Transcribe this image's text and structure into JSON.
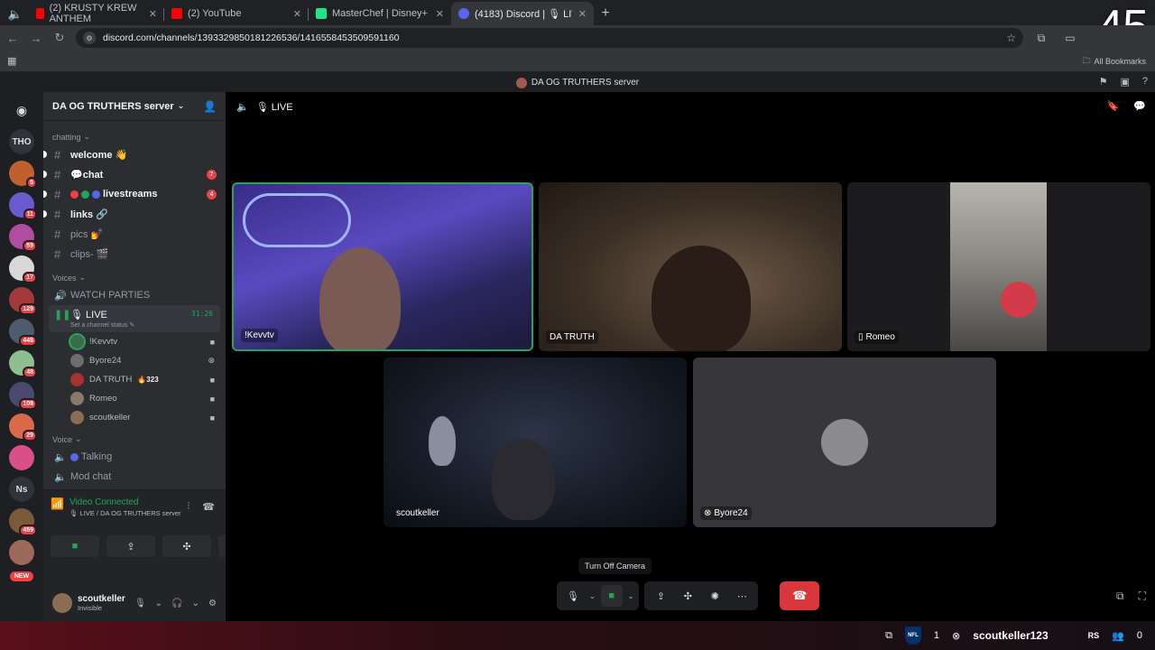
{
  "browser": {
    "tabs": [
      {
        "label": "(2) KRUSTY KREW ANTHEM",
        "favicon_color": "#ff0000",
        "active": false
      },
      {
        "label": "(2) YouTube",
        "favicon_color": "#ff0000",
        "active": false
      },
      {
        "label": "MasterChef | Disney+",
        "favicon_color": "#1ce783",
        "active": false
      },
      {
        "label": "(4183) Discord | 🎙 LIVE | D",
        "favicon_color": "#5865f2",
        "active": true
      }
    ],
    "new_tab": "+",
    "url": "discord.com/channels/1393329850181226536/1416558453509591160",
    "bookmarks_label": "All Bookmarks",
    "overlay_number": "45"
  },
  "discord": {
    "window_title": "DA OG TRUTHERS server",
    "server_name": "DA OG TRUTHERS server",
    "rail": [
      {
        "type": "logo"
      },
      {
        "type": "text",
        "label": "THO"
      },
      {
        "type": "avatar",
        "color": "#c0602f",
        "badge": "5"
      },
      {
        "type": "avatar",
        "color": "#6a5acd",
        "badge": "11"
      },
      {
        "type": "avatar",
        "color": "#b04da0",
        "badge": "59"
      },
      {
        "type": "avatar",
        "color": "#d8d8d8",
        "badge": "17"
      },
      {
        "type": "avatar",
        "color": "#a33a3a",
        "badge": "129"
      },
      {
        "type": "avatar",
        "color": "#4e5a6e",
        "badge": "448"
      },
      {
        "type": "avatar",
        "color": "#8fbf8f",
        "badge": "48"
      },
      {
        "type": "avatar",
        "color": "#4a4a70",
        "badge": "108"
      },
      {
        "type": "avatar",
        "color": "#d86a4a",
        "badge": "29"
      },
      {
        "type": "avatar",
        "color": "#d94f88",
        "badge": ""
      },
      {
        "type": "text",
        "label": "Ns"
      },
      {
        "type": "avatar",
        "color": "#7a5a3a",
        "badge": "459"
      },
      {
        "type": "avatar",
        "color": "#9a6a5a",
        "badge": ""
      },
      {
        "type": "new",
        "label": "NEW"
      }
    ],
    "categories": {
      "chatting": "chatting",
      "voices": "Voices",
      "voice": "Voice"
    },
    "text_channels": [
      {
        "name": "welcome 👋",
        "unread": true,
        "count": ""
      },
      {
        "name": "💬chat",
        "unread": true,
        "count": "7"
      },
      {
        "name": "livestreams",
        "unread": true,
        "count": "4",
        "dots": [
          "#f23f43",
          "#23a55a",
          "#5865f2"
        ]
      },
      {
        "name": "links 🔗",
        "unread": true,
        "count": ""
      },
      {
        "name": "pics 💅",
        "unread": false,
        "count": ""
      },
      {
        "name": "clips- 🎬",
        "unread": false,
        "count": ""
      }
    ],
    "watch_parties": "WATCH PARTIES",
    "live_channel": {
      "name": "🎙 LIVE",
      "timer": "31:26",
      "sub": "Set a channel status ✎"
    },
    "voice_members": [
      {
        "name": "!Kevvtv",
        "avatar_color": "#3c6a4a",
        "speaking": true,
        "fire": ""
      },
      {
        "name": "Byore24",
        "avatar_color": "#6d6d70",
        "speaking": false,
        "fire": ""
      },
      {
        "name": "DA TRUTH",
        "avatar_color": "#a83232",
        "speaking": false,
        "fire": "🔥323"
      },
      {
        "name": "Romeo",
        "avatar_color": "#8a7a6a",
        "speaking": false,
        "fire": ""
      },
      {
        "name": "scoutkeller",
        "avatar_color": "#8a6d52",
        "speaking": false,
        "fire": ""
      }
    ],
    "voice_channels": [
      {
        "name": "Talking",
        "dot": "#5865f2"
      },
      {
        "name": "Mod chat",
        "dot": ""
      }
    ],
    "rtc": {
      "status": "Video Connected",
      "where": "🎙 LIVE / DA OG TRUTHERS server"
    },
    "user": {
      "name": "scoutkeller",
      "status": "Invisible"
    },
    "stage": {
      "channel": "🎙 LIVE",
      "tiles": {
        "kevvtv": "!Kevvtv",
        "truth": "DA TRUTH",
        "romeo": "Romeo",
        "scout": "scoutkeller",
        "byore": "Byore24"
      },
      "tooltip": "Turn Off Camera"
    }
  },
  "taskbar": {
    "count": "1",
    "gamertag": "scoutkeller123",
    "rs": "RS",
    "people_count": "0"
  }
}
